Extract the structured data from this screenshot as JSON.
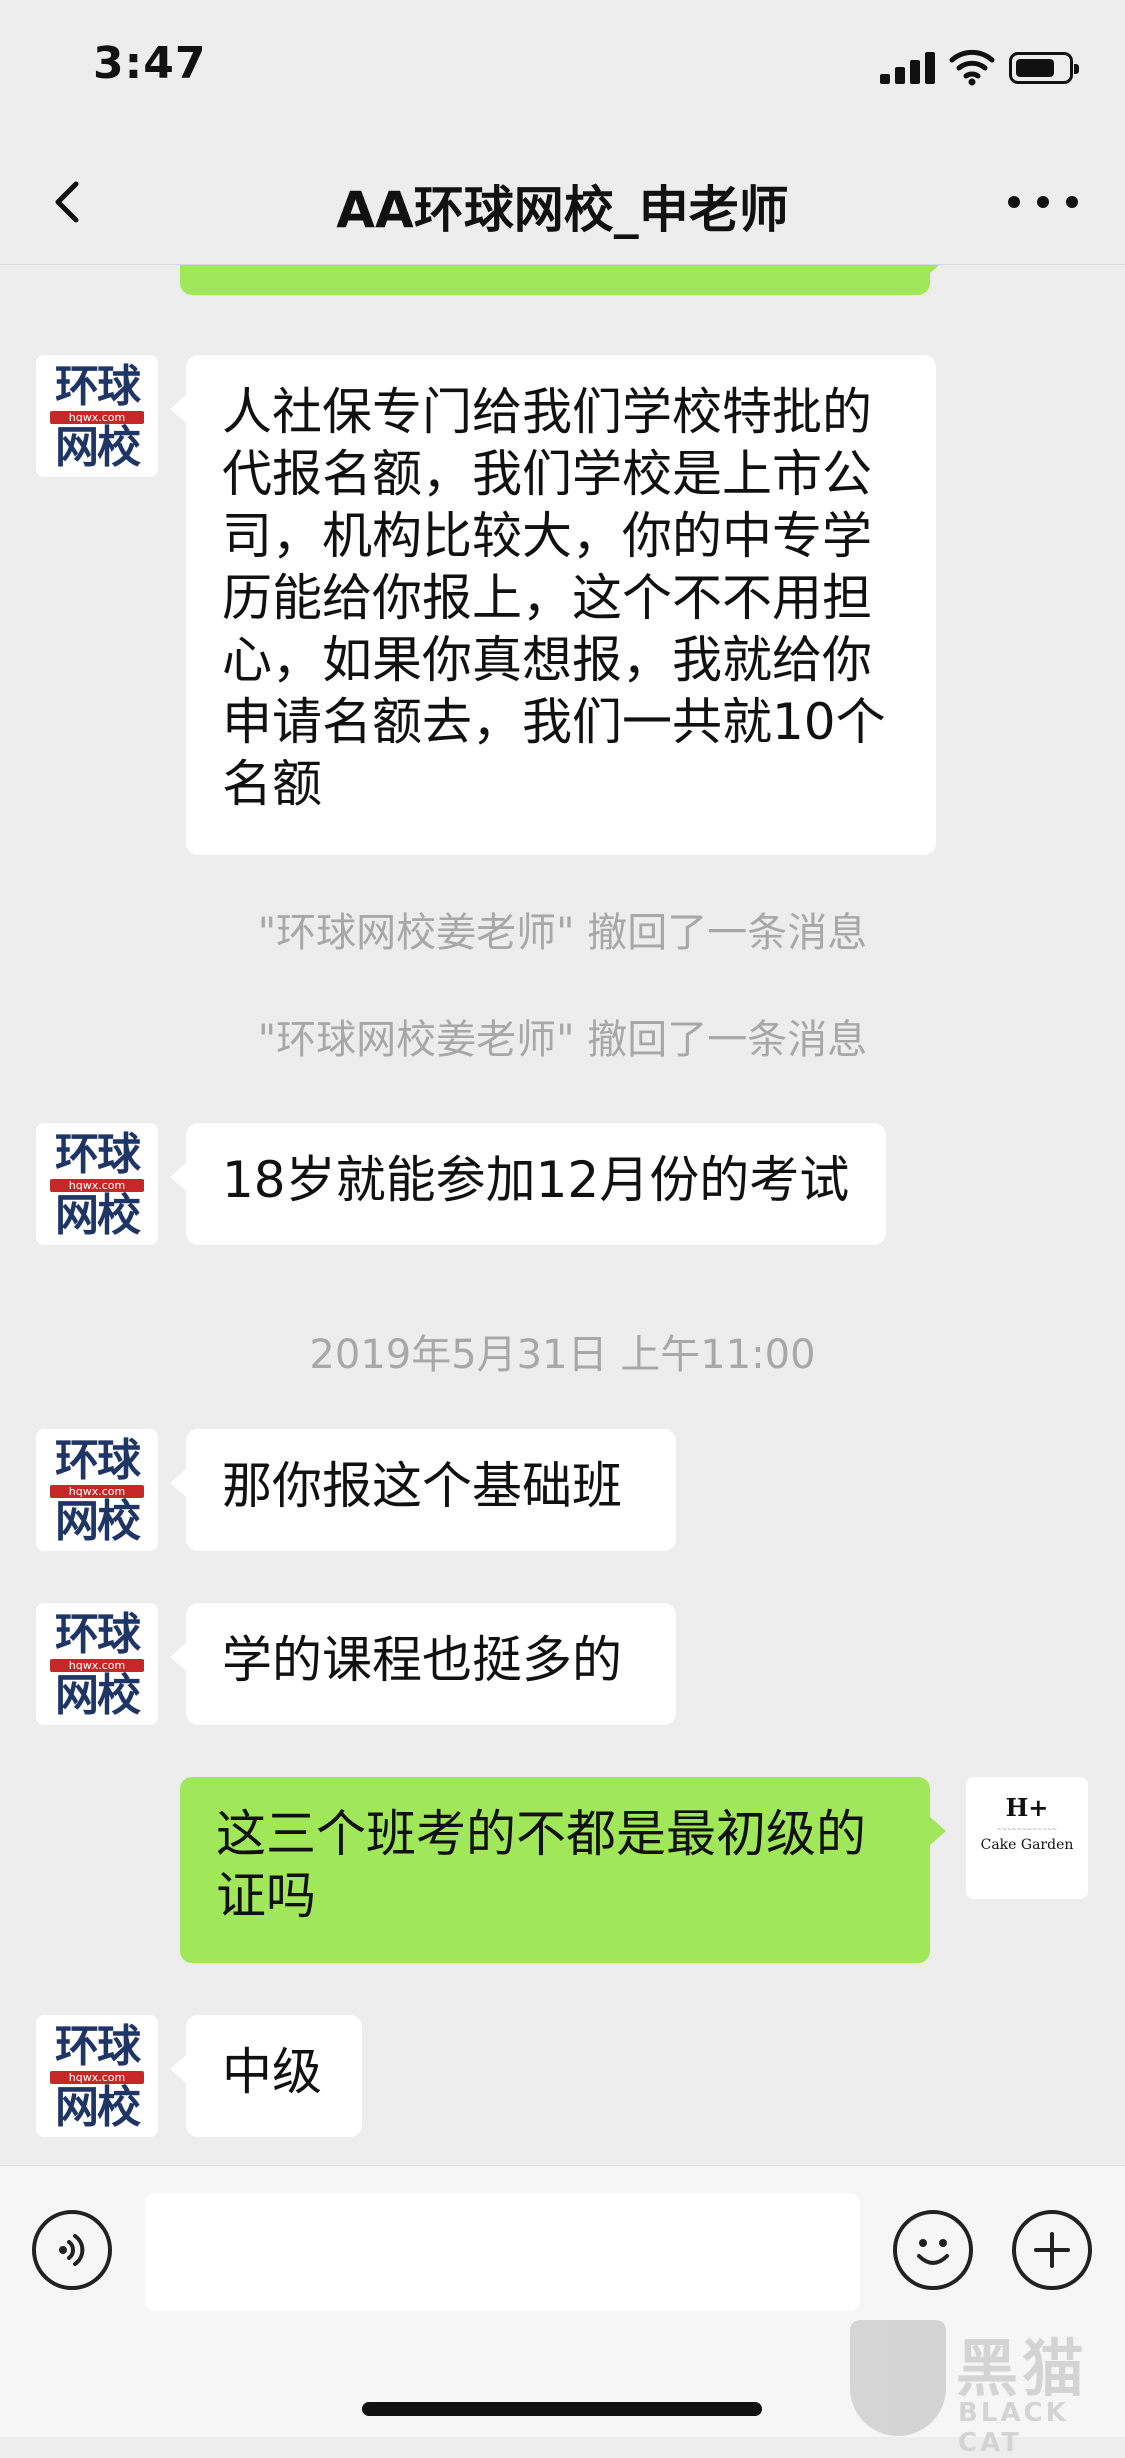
{
  "status_bar": {
    "time": "3:47"
  },
  "header": {
    "title": "AA环球网校_申老师"
  },
  "avatars": {
    "school_logo_top": "环球",
    "school_logo_url": "hqwx.com",
    "school_logo_bottom": "网校",
    "self_logo_main": "H+",
    "self_logo_sub": "Cake Garden"
  },
  "messages": [
    {
      "sender": "other",
      "lines": [
        "人社保专门给我们学校特批的",
        "代报名额，我们学校是上市公",
        "司，机构比较大，你的中专学",
        "历能给你报上，这个不不用担",
        "心，如果你真想报，我就给你",
        "申请名额去，我们一共就10个",
        "名额"
      ]
    },
    {
      "type": "system",
      "text": "\"环球网校姜老师\" 撤回了一条消息"
    },
    {
      "type": "system",
      "text": "\"环球网校姜老师\" 撤回了一条消息"
    },
    {
      "sender": "other",
      "text": "18岁就能参加12月份的考试"
    },
    {
      "type": "timestamp",
      "text": "2019年5月31日 上午11:00"
    },
    {
      "sender": "other",
      "text": "那你报这个基础班"
    },
    {
      "sender": "other",
      "text": "学的课程也挺多的"
    },
    {
      "sender": "self",
      "lines": [
        "这三个班考的不都是最初级的",
        "证吗"
      ]
    },
    {
      "sender": "other",
      "text": "中级"
    }
  ],
  "input": {
    "value": ""
  },
  "watermark": {
    "cn": "黑猫",
    "en": "BLACK CAT"
  },
  "colors": {
    "background": "#ededed",
    "self_bubble": "#a0e75a",
    "other_bubble": "#ffffff"
  }
}
